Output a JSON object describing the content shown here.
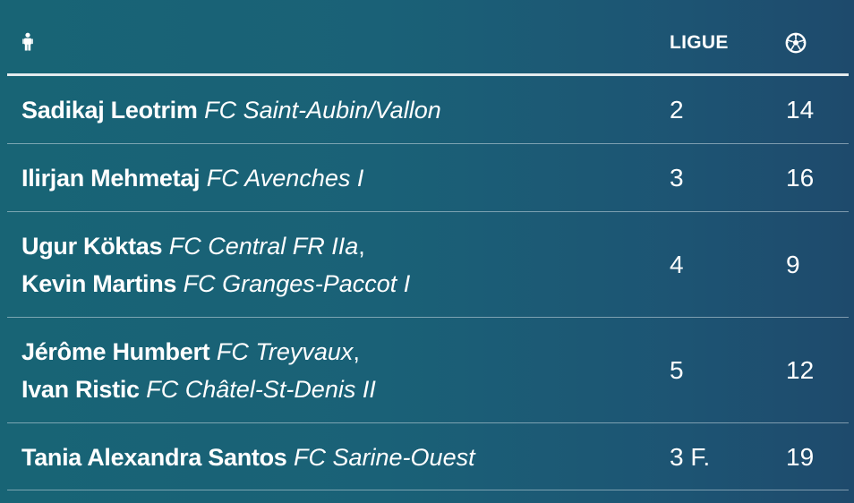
{
  "header": {
    "player_icon": "person-icon",
    "league_label": "LIGUE",
    "goals_icon": "soccer-ball-icon"
  },
  "rows": [
    {
      "players": [
        {
          "name": "Sadikaj Leotrim",
          "club": "FC Saint-Aubin/Vallon",
          "separator": ""
        }
      ],
      "league": "2",
      "goals": "14"
    },
    {
      "players": [
        {
          "name": "Ilirjan Mehmetaj",
          "club": "FC Avenches I",
          "separator": ""
        }
      ],
      "league": "3",
      "goals": "16"
    },
    {
      "players": [
        {
          "name": "Ugur Köktas",
          "club": "FC Central FR IIa",
          "separator": ","
        },
        {
          "name": "Kevin Martins",
          "club": "FC Granges-Paccot I",
          "separator": ""
        }
      ],
      "league": "4",
      "goals": "9"
    },
    {
      "players": [
        {
          "name": "Jérôme Humbert",
          "club": "FC Treyvaux",
          "separator": ","
        },
        {
          "name": "Ivan Ristic",
          "club": "FC Châtel-St-Denis II",
          "separator": ""
        }
      ],
      "league": "5",
      "goals": "12"
    },
    {
      "players": [
        {
          "name": "Tania Alexandra Santos",
          "club": "FC Sarine-Ouest",
          "separator": ""
        }
      ],
      "league": "3 F.",
      "goals": "19"
    }
  ]
}
